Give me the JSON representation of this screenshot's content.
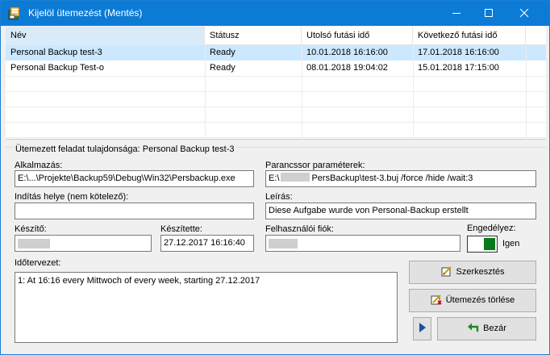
{
  "window": {
    "title": "Kijelöl ütemezést (Mentés)"
  },
  "list": {
    "columns": [
      "Név",
      "Státusz",
      "Utolsó futási idő",
      "Következő futási idő"
    ],
    "rows": [
      {
        "name": "Personal Backup test-3",
        "status": "Ready",
        "last_run": "10.01.2018 16:16:00",
        "next_run": "17.01.2018 16:16:00",
        "selected": true
      },
      {
        "name": "Personal Backup Test-o",
        "status": "Ready",
        "last_run": "08.01.2018 19:04:02",
        "next_run": "15.01.2018 17:15:00",
        "selected": false
      }
    ]
  },
  "properties": {
    "group_title": "Ütemezett feladat tulajdonsága: Personal Backup test-3",
    "application_label": "Alkalmazás:",
    "application_value": "E:\\...\\Projekte\\Backup59\\Debug\\Win32\\Persbackup.exe",
    "params_label": "Parancssor paraméterek:",
    "params_prefix": "E:\\",
    "params_suffix": "PersBackup\\test-3.buj /force /hide /wait:3",
    "start_in_label": "Indítás helye (nem kötelező):",
    "start_in_value": "",
    "description_label": "Leírás:",
    "description_value": "Diese Aufgabe wurde von Personal-Backup erstellt",
    "creator_label": "Készítő:",
    "created_label": "Készítette:",
    "created_value": "27.12.2017 16:16:40",
    "user_account_label": "Felhasználói fiók:",
    "enabled_label": "Engedélyez:",
    "enabled_value_text": "Igen",
    "enabled": true,
    "schedule_label": "Időtervezet:",
    "schedule_value": "1: At 16:16 every Mittwoch of every week, starting 27.12.2017"
  },
  "buttons": {
    "edit": "Szerkesztés",
    "delete": "Ütemezés törlése",
    "close": "Bezár"
  },
  "colors": {
    "titlebar": "#0c7bd6",
    "selected_row": "#cce8ff",
    "toggle_on": "#0a7a1a"
  }
}
